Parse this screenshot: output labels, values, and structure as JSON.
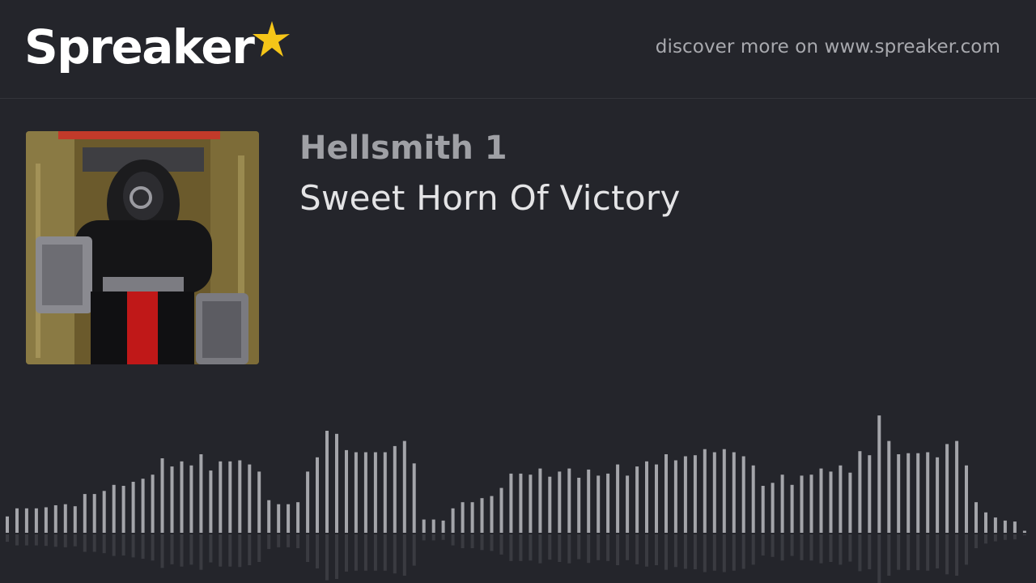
{
  "brand": {
    "name": "Spreaker",
    "star_color": "#f5c518"
  },
  "header": {
    "discover_text": "discover more on www.spreaker.com"
  },
  "episode": {
    "title": "Hellsmith 1",
    "subtitle": "Sweet Horn Of Victory"
  },
  "colors": {
    "background": "#24252b",
    "bar": "#a4a5aa",
    "reflection": "#3a3b41"
  },
  "waveform": {
    "levels": [
      0.16,
      0.24,
      0.24,
      0.24,
      0.25,
      0.27,
      0.28,
      0.26,
      0.38,
      0.38,
      0.41,
      0.47,
      0.46,
      0.5,
      0.53,
      0.57,
      0.73,
      0.65,
      0.7,
      0.66,
      0.77,
      0.61,
      0.7,
      0.7,
      0.71,
      0.67,
      0.6,
      0.32,
      0.28,
      0.28,
      0.3,
      0.6,
      0.74,
      1.0,
      0.97,
      0.81,
      0.79,
      0.79,
      0.79,
      0.79,
      0.85,
      0.9,
      0.68,
      0.13,
      0.13,
      0.12,
      0.24,
      0.3,
      0.3,
      0.34,
      0.36,
      0.44,
      0.58,
      0.58,
      0.57,
      0.63,
      0.55,
      0.6,
      0.63,
      0.54,
      0.62,
      0.56,
      0.58,
      0.67,
      0.56,
      0.65,
      0.7,
      0.67,
      0.77,
      0.71,
      0.75,
      0.76,
      0.82,
      0.79,
      0.82,
      0.79,
      0.75,
      0.66,
      0.46,
      0.49,
      0.57,
      0.47,
      0.56,
      0.57,
      0.63,
      0.6,
      0.66,
      0.59,
      0.8,
      0.76,
      1.15,
      0.9,
      0.77,
      0.78,
      0.78,
      0.79,
      0.74,
      0.87,
      0.9,
      0.66,
      0.3,
      0.2,
      0.15,
      0.12,
      0.11,
      0.02
    ]
  }
}
